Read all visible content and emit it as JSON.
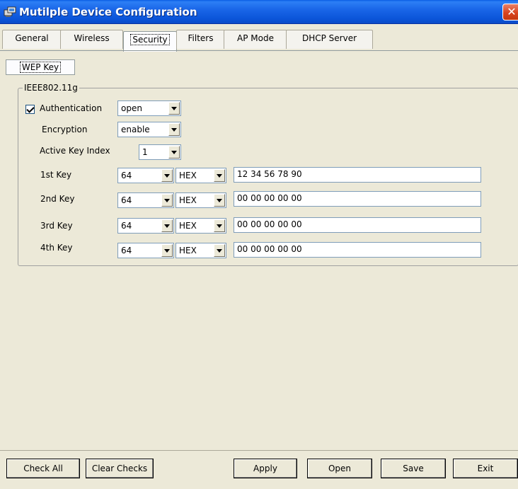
{
  "window": {
    "title": "Mutilple Device Configuration",
    "close_icon": "close-icon"
  },
  "tabs": [
    {
      "label": "General"
    },
    {
      "label": "Wireless"
    },
    {
      "label": "Security",
      "active": true
    },
    {
      "label": "Filters"
    },
    {
      "label": "AP Mode"
    },
    {
      "label": "DHCP Server"
    }
  ],
  "subtab": {
    "label": "WEP Key"
  },
  "group": {
    "title": "IEEE802.11g",
    "authentication": {
      "label": "Authentication",
      "checked": true,
      "value": "open"
    },
    "encryption": {
      "label": "Encryption",
      "value": "enable"
    },
    "active_key_index": {
      "label": "Active Key Index",
      "value": "1"
    },
    "keys": [
      {
        "label": "1st Key",
        "bits": "64",
        "format": "HEX",
        "value": "12 34 56 78 90"
      },
      {
        "label": "2nd Key",
        "bits": "64",
        "format": "HEX",
        "value": "00 00 00 00 00"
      },
      {
        "label": "3rd Key",
        "bits": "64",
        "format": "HEX",
        "value": "00 00 00 00 00"
      },
      {
        "label": "4th Key",
        "bits": "64",
        "format": "HEX",
        "value": "00 00 00 00 00"
      }
    ]
  },
  "buttons": {
    "check_all": "Check All",
    "clear_checks": "Clear Checks",
    "apply": "Apply",
    "open": "Open",
    "save": "Save",
    "exit": "Exit"
  },
  "colors": {
    "title_bar": "#0a5ee4",
    "close_button": "#d9441f",
    "window_bg": "#ece9d8"
  }
}
